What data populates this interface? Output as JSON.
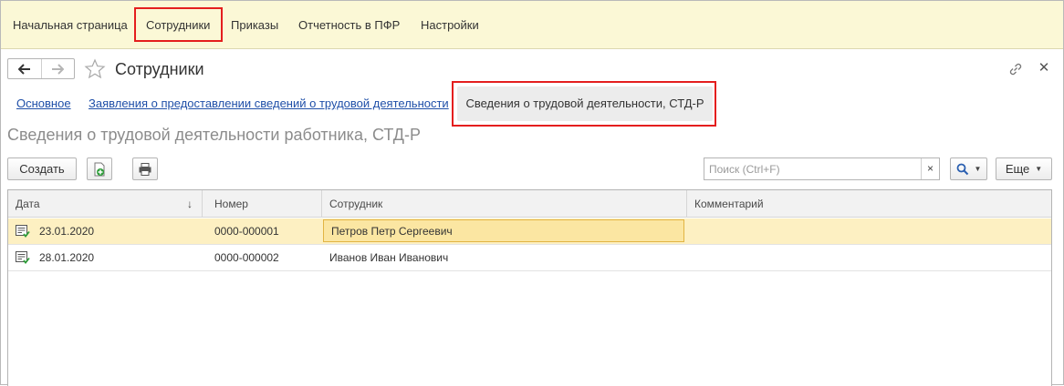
{
  "sections": [
    {
      "label": "Начальная страница"
    },
    {
      "label": "Сотрудники"
    },
    {
      "label": "Приказы"
    },
    {
      "label": "Отчетность в ПФР"
    },
    {
      "label": "Настройки"
    }
  ],
  "window": {
    "title": "Сотрудники"
  },
  "tabs": [
    {
      "label": "Основное"
    },
    {
      "label": "Заявления о предоставлении сведений о трудовой деятельности"
    },
    {
      "label": "Сведения о трудовой деятельности, СТД-Р"
    }
  ],
  "form_title": "Сведения о трудовой деятельности работника, СТД-Р",
  "toolbar": {
    "create_label": "Создать",
    "search_placeholder": "Поиск (Ctrl+F)",
    "search_clear": "×",
    "more_label": "Еще"
  },
  "table": {
    "columns": [
      "Дата",
      "Номер",
      "Сотрудник",
      "Комментарий"
    ],
    "rows": [
      {
        "date": "23.01.2020",
        "number": "0000-000001",
        "employee": "Петров Петр Сергеевич",
        "comment": ""
      },
      {
        "date": "28.01.2020",
        "number": "0000-000002",
        "employee": "Иванов Иван Иванович",
        "comment": ""
      }
    ]
  },
  "colors": {
    "section_bar": "#fbf8d6",
    "highlight_red": "#e41e1e",
    "link_blue": "#1f4fa8",
    "selected_row": "#fdf0c2"
  }
}
